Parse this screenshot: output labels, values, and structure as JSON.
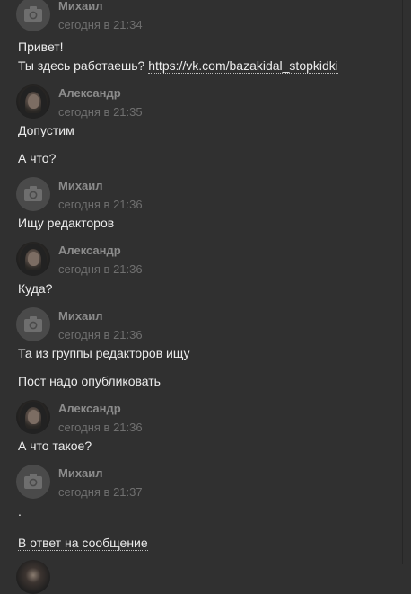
{
  "messages": [
    {
      "author": "Михаил",
      "time": "сегодня в 21:34",
      "line1": "Привет!",
      "line2_prefix": "Ты здесь работаешь? ",
      "link": "https://vk.com/bazakidal_stopkidki"
    },
    {
      "author": "Александр",
      "time": "сегодня в 21:35",
      "line1": "Допустим",
      "line2": "А что?"
    },
    {
      "author": "Михаил",
      "time": "сегодня в 21:36",
      "line1": "Ищу редакторов"
    },
    {
      "author": "Александр",
      "time": "сегодня в 21:36",
      "line1": "Куда?"
    },
    {
      "author": "Михаил",
      "time": "сегодня в 21:36",
      "line1": "Та из группы редакторов ищу",
      "line2": "Пост надо опубликовать"
    },
    {
      "author": "Александр",
      "time": "сегодня в 21:36",
      "line1": "А что такое?"
    },
    {
      "author": "Михаил",
      "time": "сегодня в 21:37",
      "line1": ".",
      "reply": "В ответ на сообщение"
    }
  ],
  "icons": {
    "placeholder_avatar": "camera-icon",
    "user_avatar": "user-photo"
  },
  "colors": {
    "background": "#303030",
    "text": "#ececec",
    "author": "#8c8c8c",
    "time": "#6f6f6f",
    "placeholder": "#4a4a4a"
  }
}
